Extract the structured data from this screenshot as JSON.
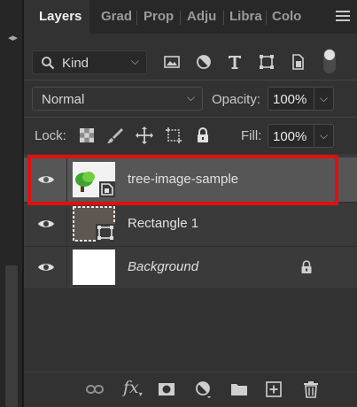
{
  "tabs": [
    {
      "label": "Layers",
      "active": true
    },
    {
      "label": "Grad",
      "active": false
    },
    {
      "label": "Prop",
      "active": false
    },
    {
      "label": "Adju",
      "active": false
    },
    {
      "label": "Libra",
      "active": false
    },
    {
      "label": "Colo",
      "active": false
    }
  ],
  "filter": {
    "kind_label": "Kind",
    "icons": [
      "image-filter-icon",
      "adjustment-filter-icon",
      "type-filter-icon",
      "shape-filter-icon",
      "smart-object-filter-icon"
    ],
    "filter_toggle_on": true
  },
  "blend": {
    "mode": "Normal",
    "opacity_label": "Opacity:",
    "opacity_value": "100%"
  },
  "lock": {
    "label": "Lock:",
    "icons": [
      "lock-transparent-icon",
      "lock-image-icon",
      "lock-position-icon",
      "lock-artboard-icon",
      "lock-all-icon"
    ],
    "fill_label": "Fill:",
    "fill_value": "100%"
  },
  "layers": [
    {
      "name": "tree-image-sample",
      "type": "smart-object",
      "visible": true,
      "selected": true,
      "locked": false
    },
    {
      "name": "Rectangle 1",
      "type": "shape",
      "visible": true,
      "selected": false,
      "locked": false
    },
    {
      "name": "Background",
      "type": "background",
      "visible": true,
      "selected": false,
      "locked": true
    }
  ],
  "bottom_toolbar": {
    "fx_label": "fx",
    "icons": [
      "link-layers-icon",
      "layer-style-icon",
      "add-mask-icon",
      "adjustment-layer-icon",
      "new-group-icon",
      "new-layer-icon",
      "delete-layer-icon"
    ]
  },
  "colors": {
    "highlight": "#e10f0f",
    "panel": "#323232",
    "selected_row": "#565656"
  }
}
